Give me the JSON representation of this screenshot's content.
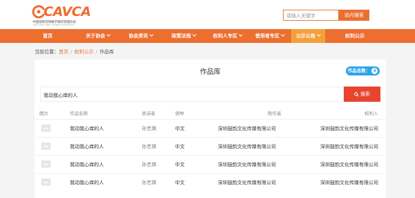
{
  "header": {
    "logo_text": "CAVCA",
    "logo_sub": "中国视频音频数字版权管理协会",
    "logo_sub2": "CHINA AUDIO-VIDEO COPYRIGHT ASSOCIATION",
    "search_placeholder": "请输入关键字",
    "search_button": "站内搜索"
  },
  "nav": {
    "items": [
      {
        "label": "首页",
        "has_dropdown": false
      },
      {
        "label": "关于协会",
        "has_dropdown": true
      },
      {
        "label": "协会资讯",
        "has_dropdown": true
      },
      {
        "label": "政策法规",
        "has_dropdown": true
      },
      {
        "label": "权利人专区",
        "has_dropdown": true
      },
      {
        "label": "使用者专区",
        "has_dropdown": true
      },
      {
        "label": "公示公告",
        "has_dropdown": true,
        "active": true
      },
      {
        "label": "权利公示",
        "has_dropdown": false
      }
    ]
  },
  "breadcrumb": {
    "prefix": "当前位置：",
    "items": [
      "首页",
      "权利公示",
      "作品库"
    ]
  },
  "panel": {
    "title": "作品库",
    "count_label": "作品总数：",
    "count": "4",
    "query": "我动我心痒的人",
    "search_button": "搜索"
  },
  "table": {
    "headers": [
      "图片",
      "作品名称",
      "表演者",
      "语种",
      "制作者",
      "权利人"
    ],
    "rows": [
      {
        "name": "我动我心痒的人",
        "performer": "孙艺琪",
        "language": "中文",
        "producer": "深圳鼓韵文化传媒有限公司",
        "owner": "深圳鼓韵文化传媒有限公司"
      },
      {
        "name": "我动我心痒的人",
        "performer": "孙艺琪",
        "language": "中文",
        "producer": "深圳鼓韵文化传媒有限公司",
        "owner": "深圳鼓韵文化传媒有限公司"
      },
      {
        "name": "我动我心痒的人",
        "performer": "孙艺琪",
        "language": "中文",
        "producer": "深圳鼓韵文化传媒有限公司",
        "owner": "深圳鼓韵文化传媒有限公司"
      },
      {
        "name": "我动我心痒的人",
        "performer": "孙艺琪",
        "language": "中文",
        "producer": "深圳鼓韵文化传媒有限公司",
        "owner": "深圳鼓韵文化传媒有限公司"
      }
    ]
  },
  "colors": {
    "brand": "#ec6f30",
    "nav_active": "#f3a03c",
    "search_red": "#e8442f",
    "badge_blue": "#2aa4e8"
  }
}
